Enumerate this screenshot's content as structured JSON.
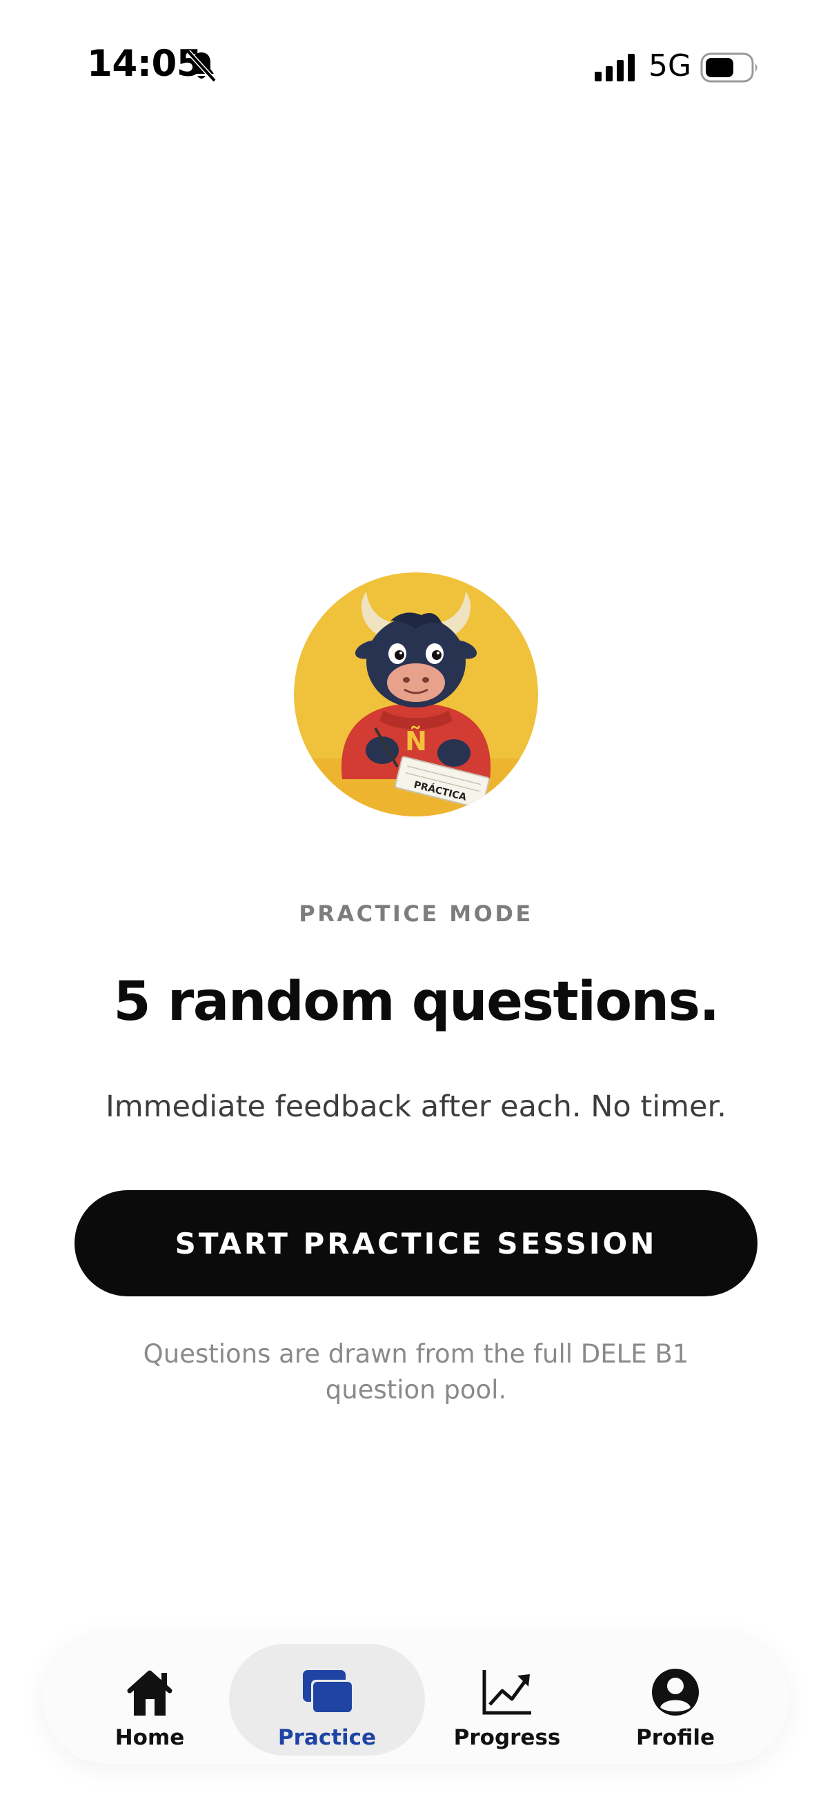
{
  "status_bar": {
    "time": "14:05",
    "network": "5G",
    "icons": [
      "bell-off-icon",
      "signal-icon",
      "battery-icon"
    ]
  },
  "mascot": {
    "icon": "bull-mascot",
    "notebook_text": "PRÁCTICA",
    "hoodie_letter": "Ñ"
  },
  "practice": {
    "mode_label": "PRACTICE MODE",
    "headline": "5 random questions.",
    "subline": "Immediate feedback after each. No timer.",
    "start_button_label": "START PRACTICE SESSION",
    "footnote": "Questions are drawn from the full DELE B1 question pool."
  },
  "nav": {
    "active": "practice",
    "items": [
      {
        "id": "home",
        "label": "Home",
        "icon": "home-icon"
      },
      {
        "id": "practice",
        "label": "Practice",
        "icon": "cards-icon"
      },
      {
        "id": "progress",
        "label": "Progress",
        "icon": "trend-up-icon"
      },
      {
        "id": "profile",
        "label": "Profile",
        "icon": "profile-icon"
      }
    ]
  },
  "colors": {
    "accent": "#1f44a3",
    "button": "#0b0b0b",
    "mascot_background": "#f0c23b",
    "hoodie": "#d23c33"
  }
}
